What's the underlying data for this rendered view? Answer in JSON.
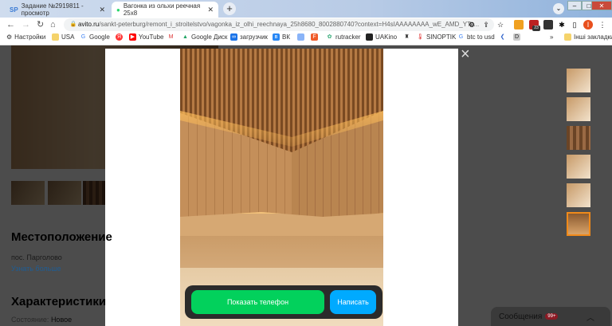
{
  "browser": {
    "tabs": [
      {
        "label": "Задание №2919811 - просмотр",
        "icon": "SP"
      },
      {
        "label": "Вагонка из ольхи реечная 25x8",
        "icon": "avito-icon"
      }
    ],
    "url_host": "avito.ru",
    "url_path": "/sankt-peterburg/remont_i_stroitelstvo/vagonka_iz_olhi_reechnaya_25h8680_8002880740?context=H4sIAAAAAAAA_wE_AMD_YTo...",
    "profile_initial": "I",
    "ext_badge": "23",
    "bookmarks": [
      "Настройки",
      "USA",
      "Google",
      "",
      "YouTube",
      "",
      "Google Диск",
      "загрузчик",
      "ВК",
      "",
      "",
      "rutracker",
      "UAKino",
      "",
      "SINOPTIK",
      "btc to usd",
      "",
      ""
    ],
    "other_bookmarks": "Інші закладки"
  },
  "page": {
    "location_title": "Местоположение",
    "location": "пос. Парголово",
    "learn_more": "Узнать больше",
    "specs_title": "Характеристики",
    "condition_label": "Состояние:",
    "condition_value": "Новое"
  },
  "modal": {
    "phone_button": "Показать телефон",
    "message_button": "Написать",
    "close": "×"
  },
  "messages": {
    "label": "Сообщения",
    "badge": "99+"
  },
  "colors": {
    "green": "#02d15c",
    "blue": "#00aaff"
  }
}
